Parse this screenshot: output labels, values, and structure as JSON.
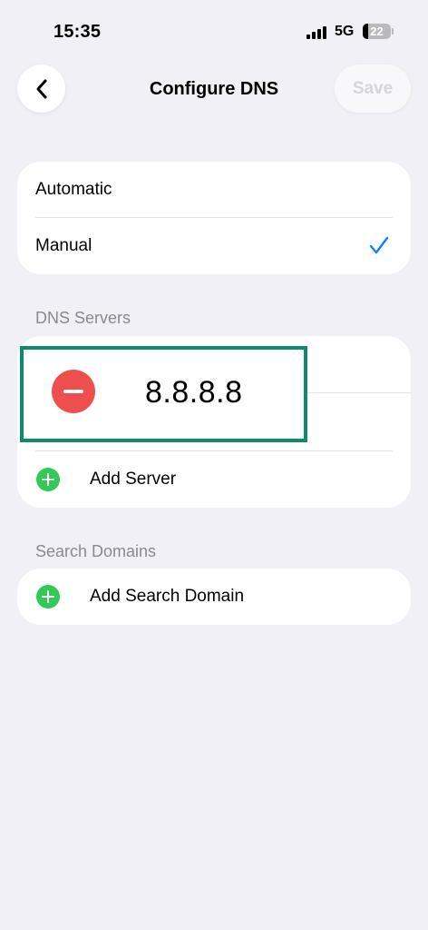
{
  "status_bar": {
    "time": "15:35",
    "network": "5G",
    "battery": "22"
  },
  "nav": {
    "title": "Configure DNS",
    "save_label": "Save"
  },
  "mode": {
    "options": [
      {
        "label": "Automatic",
        "selected": false
      },
      {
        "label": "Manual",
        "selected": true
      }
    ]
  },
  "dns_servers": {
    "header": "DNS Servers",
    "servers": [
      "8.8.8.8"
    ],
    "add_label": "Add Server"
  },
  "search_domains": {
    "header": "Search Domains",
    "add_label": "Add Search Domain"
  },
  "colors": {
    "background": "#f1f0f6",
    "accent": "#0a84ff",
    "add_green": "#34c759",
    "remove_red": "#ee4e4e",
    "highlight": "#0e8a6c"
  }
}
